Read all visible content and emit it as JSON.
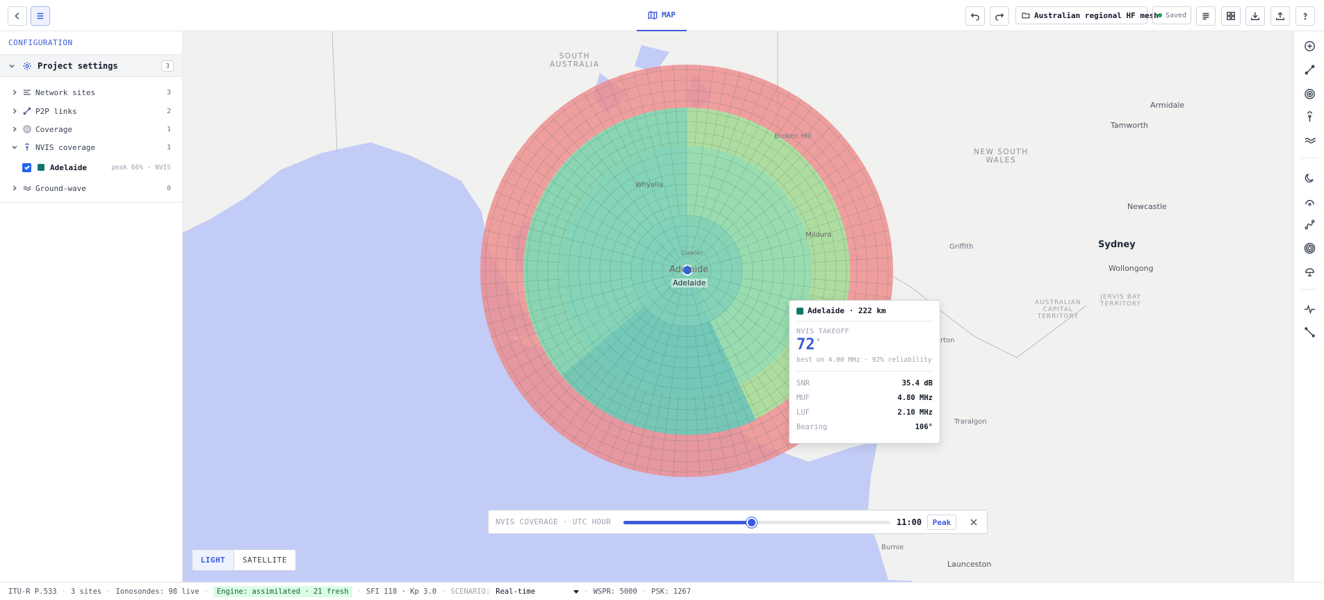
{
  "topbar": {
    "map_tab": "MAP",
    "project_name": "Australian regional HF mesh",
    "saved_label": "Saved"
  },
  "sidebar": {
    "header": "CONFIGURATION",
    "project_settings": {
      "label": "Project settings",
      "count": "3"
    },
    "items": [
      {
        "label": "Network sites",
        "count": "3"
      },
      {
        "label": "P2P links",
        "count": "2"
      },
      {
        "label": "Coverage",
        "count": "1"
      },
      {
        "label": "NVIS coverage",
        "count": "1"
      },
      {
        "label": "Ground-wave",
        "count": "0"
      }
    ],
    "nvis_child": {
      "label": "Adelaide",
      "meta": "peak 66% · NVIS",
      "swatch_color": "#0f766e"
    }
  },
  "map": {
    "labels": {
      "south_australia": "SOUTH\nAUSTRALIA",
      "nsw": "NEW SOUTH\nWALES",
      "act": "AUSTRALIAN\nCAPITAL\nTERRITORY",
      "jervis": "JERVIS BAY\nTERRITORY",
      "armidale": "Armidale",
      "tamworth": "Tamworth",
      "newcastle": "Newcastle",
      "sydney": "Sydney",
      "wollongong": "Wollongong",
      "griffith": "Griffith",
      "broken_hill": "Broken Hill",
      "whyalla": "Whyalla",
      "mildura": "Mildura",
      "gawler": "Gawler",
      "adelaide_map": "Adelaide",
      "adelaide_site": "Adelaide",
      "horton": "rton",
      "traralgon": "Traralgon",
      "burnie": "Burnie",
      "launceston": "Launceston"
    },
    "coverage_colors": {
      "poor": "#ef8a8a",
      "fair": "#a7e3a0",
      "good": "#7fd1b9",
      "best": "#5bb8b0"
    }
  },
  "tooltip": {
    "title": "Adelaide · 222 km",
    "subtitle": "NVIS TAKEOFF",
    "value": "72",
    "unit": "°",
    "best": "best on 4.00 MHz · 92% reliability",
    "rows": [
      {
        "k": "SNR",
        "v": "35.4 dB"
      },
      {
        "k": "MUF",
        "v": "4.80 MHz"
      },
      {
        "k": "LUF",
        "v": "2.10 MHz"
      },
      {
        "k": "Bearing",
        "v": "106°"
      }
    ]
  },
  "timebar": {
    "label": "NVIS COVERAGE · UTC HOUR",
    "hour": "11:00",
    "slider_fraction": 0.48,
    "peak_label": "Peak"
  },
  "basemap": {
    "light": "LIGHT",
    "satellite": "SATELLITE"
  },
  "statusbar": {
    "model": "ITU-R P.533",
    "sites": "3 sites",
    "ionosondes": "Ionosondes: 98 live",
    "engine": "Engine: assimilated · 21 fresh",
    "sfi": "SFI 118 · Kp 3.0",
    "scenario_label": "SCENARIO:",
    "scenario_value": "Real-time",
    "wspr": "WSPR: 5000",
    "psk": "PSK: 1267"
  }
}
